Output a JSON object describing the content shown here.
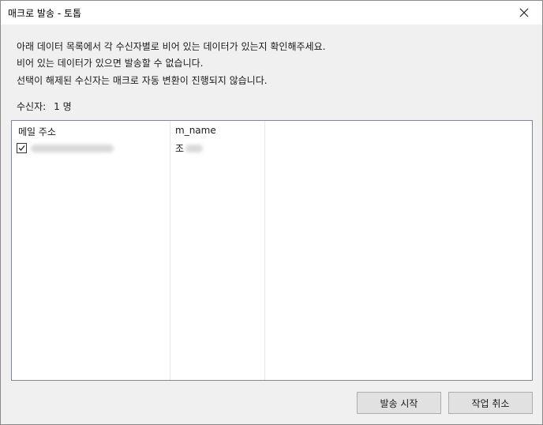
{
  "window": {
    "title": "매크로 발송 - 토톱",
    "close_icon": "close-icon"
  },
  "messages": [
    "아래 데이터 목록에서 각 수신자별로 비어 있는 데이터가 있는지 확인해주세요.",
    "비어 있는 데이터가 있으면 발송할 수 없습니다.",
    "선택이 해제된 수신자는 매크로 자동 변환이 진행되지 않습니다."
  ],
  "recipients": {
    "label": "수신자:",
    "count": "1 명"
  },
  "table": {
    "columns": [
      "메일 주소",
      "m_name",
      ""
    ],
    "rows": [
      {
        "checked": true,
        "name_prefix": "조"
      }
    ]
  },
  "buttons": {
    "start": "발송 시작",
    "cancel": "작업 취소"
  },
  "colors": {
    "window_bg": "#f0f0f0",
    "titlebar_bg": "#ffffff",
    "button_bg": "#e1e1e1",
    "list_border": "#828790"
  }
}
